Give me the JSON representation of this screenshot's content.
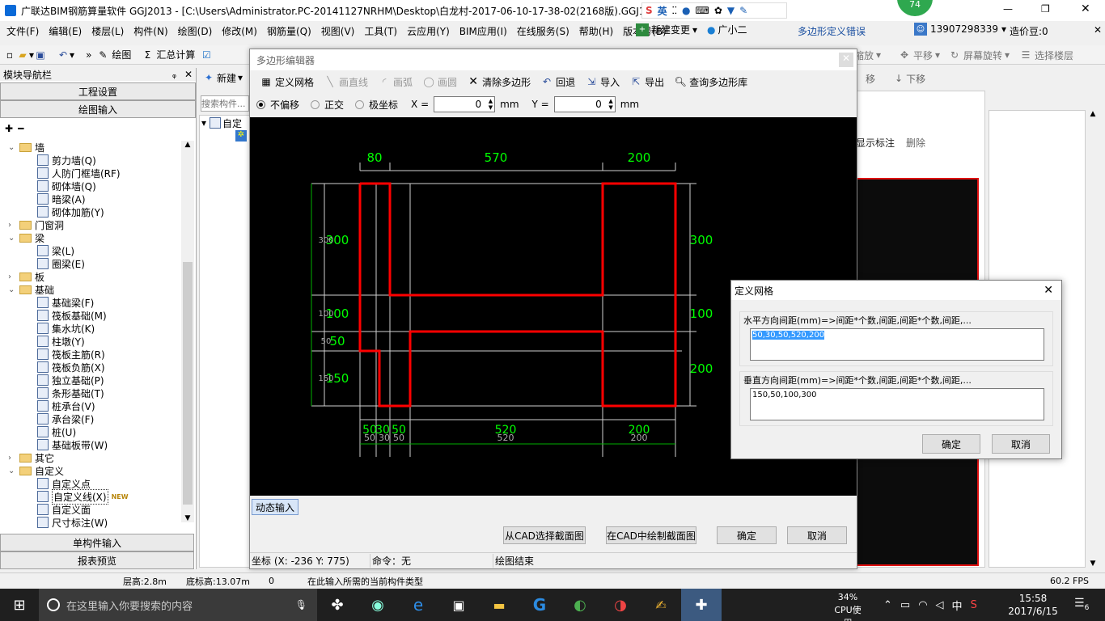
{
  "title_bar": {
    "title": "广联达BIM钢筋算量软件 GGJ2013 - [C:\\Users\\Administrator.PC-20141127NRHM\\Desktop\\白龙村-2017-06-10-17-38-02(2168版).GGJ12",
    "ime_label": "英",
    "badge": "74"
  },
  "menu": [
    "文件(F)",
    "编辑(E)",
    "楼层(L)",
    "构件(N)",
    "绘图(D)",
    "修改(M)",
    "钢筋量(Q)",
    "视图(V)",
    "工具(T)",
    "云应用(Y)",
    "BIM应用(I)",
    "在线服务(S)",
    "帮助(H)",
    "版本号(B)"
  ],
  "menu_right": {
    "new_change": "新建变更",
    "assistant": "广小二",
    "error_msg": "多边形定义错误",
    "phone": "13907298339",
    "price": "造价豆:0"
  },
  "toolbar": {
    "draw": "绘图",
    "sum": "汇总计算",
    "zoom": "缩放",
    "pan": "平移",
    "rotate": "屏幕旋转",
    "select_floor": "选择楼层",
    "move_down": "下移",
    "move_up": "移",
    "show_label": "显示标注",
    "delete": "删除"
  },
  "nav": {
    "title": "模块导航栏",
    "project_settings": "工程设置",
    "draw_input": "绘图输入",
    "single_input": "单构件输入",
    "report": "报表预览",
    "tree": [
      {
        "label": "墙",
        "level": 0,
        "type": "folder",
        "expand": "v"
      },
      {
        "label": "剪力墙(Q)",
        "level": 1
      },
      {
        "label": "人防门框墙(RF)",
        "level": 1
      },
      {
        "label": "砌体墙(Q)",
        "level": 1
      },
      {
        "label": "暗梁(A)",
        "level": 1
      },
      {
        "label": "砌体加筋(Y)",
        "level": 1
      },
      {
        "label": "门窗洞",
        "level": 0,
        "type": "folder",
        "expand": ">"
      },
      {
        "label": "梁",
        "level": 0,
        "type": "folder",
        "expand": "v"
      },
      {
        "label": "梁(L)",
        "level": 1
      },
      {
        "label": "圈梁(E)",
        "level": 1
      },
      {
        "label": "板",
        "level": 0,
        "type": "folder",
        "expand": ">"
      },
      {
        "label": "基础",
        "level": 0,
        "type": "folder",
        "expand": "v"
      },
      {
        "label": "基础梁(F)",
        "level": 1
      },
      {
        "label": "筏板基础(M)",
        "level": 1
      },
      {
        "label": "集水坑(K)",
        "level": 1
      },
      {
        "label": "柱墩(Y)",
        "level": 1
      },
      {
        "label": "筏板主筋(R)",
        "level": 1
      },
      {
        "label": "筏板负筋(X)",
        "level": 1
      },
      {
        "label": "独立基础(P)",
        "level": 1
      },
      {
        "label": "条形基础(T)",
        "level": 1
      },
      {
        "label": "桩承台(V)",
        "level": 1
      },
      {
        "label": "承台梁(F)",
        "level": 1
      },
      {
        "label": "桩(U)",
        "level": 1
      },
      {
        "label": "基础板带(W)",
        "level": 1
      },
      {
        "label": "其它",
        "level": 0,
        "type": "folder",
        "expand": ">"
      },
      {
        "label": "自定义",
        "level": 0,
        "type": "folder",
        "expand": "v"
      },
      {
        "label": "自定义点",
        "level": 1
      },
      {
        "label": "自定义线(X)",
        "level": 1,
        "selected": true,
        "badge": "NEW"
      },
      {
        "label": "自定义面",
        "level": 1
      },
      {
        "label": "尺寸标注(W)",
        "level": 1
      }
    ]
  },
  "mid_panel": {
    "new_label": "新建",
    "search_placeholder": "搜索构件...",
    "tree_item": "自定"
  },
  "editor": {
    "title": "多边形编辑器",
    "define_grid": "定义网格",
    "draw_line": "画直线",
    "draw_arc": "画弧",
    "draw_circle": "画圆",
    "clear": "清除多边形",
    "undo": "回退",
    "import": "导入",
    "export": "导出",
    "query": "查询多边形库",
    "radio_no_offset": "不偏移",
    "radio_ortho": "正交",
    "radio_polar": "极坐标",
    "x_label": "X =",
    "x_value": "0",
    "y_label": "Y =",
    "y_value": "0",
    "unit": "mm",
    "dyn_input": "动态输入",
    "from_cad": "从CAD选择截面图",
    "in_cad": "在CAD中绘制截面图",
    "ok": "确定",
    "cancel": "取消",
    "coord": "坐标 (X: -236 Y: 775)",
    "command": "命令：无",
    "status": "绘图结束",
    "dims": {
      "top": [
        "80",
        "570",
        "200"
      ],
      "bottom_main": [
        "50",
        "30",
        "50",
        "520",
        "200"
      ],
      "bottom_sub": [
        "50",
        "30",
        "50",
        "520",
        "200"
      ],
      "left_main": [
        "300",
        "100",
        "50",
        "150"
      ],
      "left_sub": [
        "300",
        "100",
        "50",
        "150"
      ],
      "right": [
        "300",
        "100",
        "200"
      ]
    }
  },
  "grid_dialog": {
    "title": "定义网格",
    "h_label": "水平方向间距(mm)=>间距*个数,间距,间距*个数,间距,...",
    "h_value": "50,30,50,520,200",
    "v_label": "垂直方向间距(mm)=>间距*个数,间距,间距*个数,间距,...",
    "v_value": "150,50,100,300",
    "ok": "确定",
    "cancel": "取消"
  },
  "statusbar": {
    "floor_h": "层高:2.8m",
    "base_h": "底标高:13.07m",
    "num": "0",
    "hint": "在此输入所需的当前构件类型",
    "fps": "60.2 FPS"
  },
  "taskbar": {
    "search_placeholder": "在这里输入你要搜索的内容",
    "cpu": "34%",
    "cpu_label": "CPU使用",
    "lang": "中",
    "time": "15:58",
    "date": "2017/6/15",
    "notif": "6"
  },
  "colors": {
    "accent": "#0078d7",
    "red": "#ff0000",
    "green": "#00ff00",
    "taskbar": "#1f1f1f"
  }
}
